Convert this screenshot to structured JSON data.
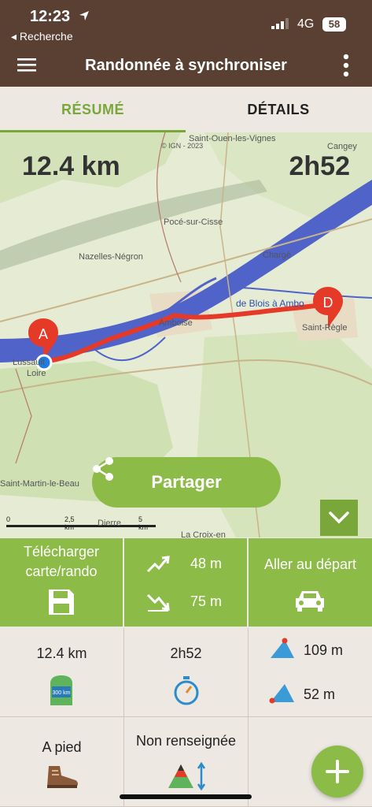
{
  "status_bar": {
    "time": "12:23",
    "back_label": "◂ Recherche",
    "network": "4G",
    "battery": "58"
  },
  "header": {
    "title": "Randonnée à synchroniser"
  },
  "tabs": [
    {
      "label": "RÉSUMÉ",
      "active": true
    },
    {
      "label": "DÉTAILS",
      "active": false
    }
  ],
  "map": {
    "distance": "12.4 km",
    "duration": "2h52",
    "places": [
      "Saint-Ouen-les-Vignes",
      "Cangey",
      "Pocé-sur-Cisse",
      "Nazelles-Négron",
      "Chargé",
      "Amboise",
      "Saint-Règle",
      "Lussault",
      "Loire",
      "Saint-Martin-le-Beau",
      "Dierre",
      "La Croix-en"
    ],
    "route_label": "de Blois à Ambo",
    "copyright": "© IGN - 2023",
    "markers": {
      "start": "A",
      "end": "D"
    },
    "scale": [
      "0",
      "2,5 km",
      "5 km"
    ],
    "share_label": "Partager"
  },
  "actions": {
    "download_label_1": "Télécharger",
    "download_label_2": "carte/rando",
    "ascent": "48 m",
    "descent": "75 m",
    "go_start_label": "Aller au départ"
  },
  "stats": {
    "distance": "12.4 km",
    "distance_icon_text": "300 km",
    "duration": "2h52",
    "max_alt": "109 m",
    "min_alt": "52 m",
    "mode": "A pied",
    "difficulty": "Non renseignée"
  },
  "colors": {
    "header": "#5a4033",
    "accent": "#8dbb48",
    "route": "#e53a28"
  }
}
